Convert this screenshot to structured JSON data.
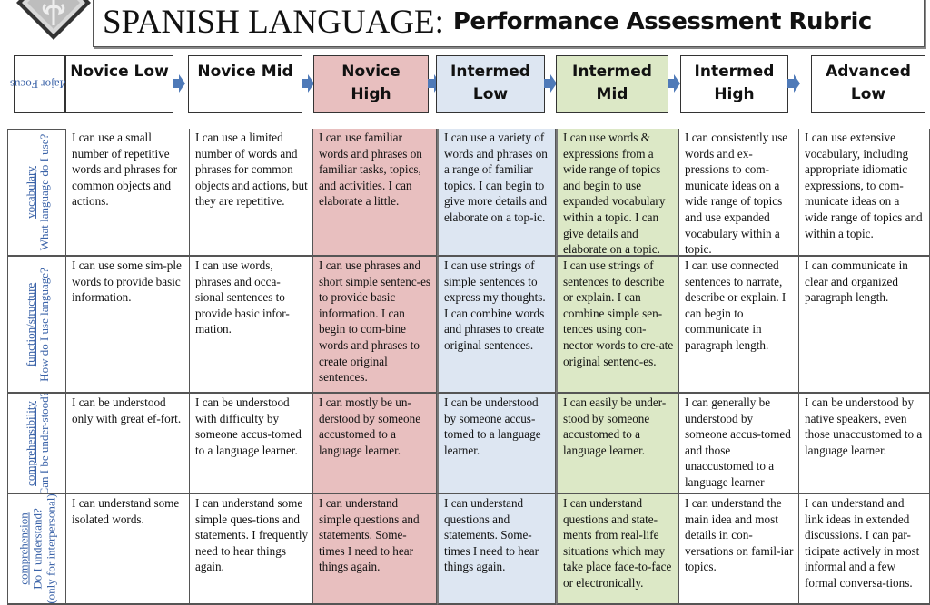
{
  "header": {
    "logo_icon": "fleur-de-lis-shield-icon",
    "title_main": "SPANISH LANGUAGE:",
    "title_sub": "Performance Assessment Rubric"
  },
  "major_focus_label": "Major Focus",
  "colors": {
    "novice_high_bg": "#e8bfbf",
    "intermed_low_bg": "#dde6f2",
    "intermed_mid_bg": "#dce8c6",
    "arrow": "#4f7ab8",
    "row_label": "#3b63a8"
  },
  "levels": [
    {
      "label": "Novice Low",
      "label_lines": [
        "Novice Low"
      ]
    },
    {
      "label": "Novice Mid",
      "label_lines": [
        "Novice Mid"
      ]
    },
    {
      "label": "Novice High",
      "label_lines": [
        "Novice",
        "High"
      ]
    },
    {
      "label": "Intermed Low",
      "label_lines": [
        "Intermed",
        "Low"
      ]
    },
    {
      "label": "Intermed Mid",
      "label_lines": [
        "Intermed",
        "Mid"
      ]
    },
    {
      "label": "Intermed High",
      "label_lines": [
        "Intermed",
        "High"
      ]
    },
    {
      "label": "Advanced Low",
      "label_lines": [
        "Advanced",
        "Low"
      ]
    }
  ],
  "rows": [
    {
      "focus": "vocabulary",
      "question": "What language do I use?",
      "cells": [
        "I can use a small number of repetitive words and phrases for common objects and actions.",
        "I can use a limited number of words and phrases for common objects and actions, but they are repetitive.",
        "I can use familiar words and phrases on familiar tasks, topics, and activities. I can elaborate a little.",
        "I can use a variety of words and phrases on a range of familiar topics. I can begin to give more details and elaborate on a top-ic.",
        "I can use words & expressions from a wide range of topics and begin to use expanded vocabulary within a topic. I can give details and elaborate on a topic.",
        "I can consistently use words and ex-pressions to com-municate ideas on a wide range of topics and use expanded vocabulary within a topic.",
        "I can use extensive vocabulary, including appropriate idiomatic expressions, to com-municate ideas on a wide range of topics and within a topic."
      ]
    },
    {
      "focus": "function/structure",
      "question": "How do I use language?",
      "cells": [
        "I can use some sim-ple words to provide basic information.",
        "I can use words, phrases and occa-sional sentences to provide basic infor-mation.",
        "I can use phrases and short simple sentenc-es to provide basic information. I can begin to com-bine words and phrases to create original sentences.",
        "I can use strings of simple sentences to express my thoughts. I can combine words and phrases to create original sentences.",
        "I can use strings of sentences to describe or explain. I can combine simple sen-tences using con-nector words to cre-ate original sentenc-es.",
        "I can use connected sentences to narrate, describe or explain. I can begin to communicate in paragraph length.",
        "I can communicate in clear and organized paragraph length."
      ]
    },
    {
      "focus": "comprehensibility",
      "question": "Can I be under-stood?",
      "cells": [
        "I can be understood only with great ef-fort.",
        "I can be understood with difficulty by someone accus-tomed to a language learner.",
        "I can mostly be un-derstood by someone accustomed to a language learner.",
        "I can be understood by someone accus-tomed to a language learner.",
        "I can easily be under-stood by someone accustomed to a language learner.",
        "I can generally be understood by someone accus-tomed and those unaccustomed to a language learner",
        "I can be understood by native speakers, even those unaccustomed to a language learner."
      ]
    },
    {
      "focus": "comprehension",
      "question": "Do I understand?",
      "note": "(only for interpersonal)",
      "cells": [
        "I can understand some isolated words.",
        "I can understand some simple ques-tions and statements. I frequently need to hear things again.",
        "I can understand simple questions and statements. Some-times I need to hear things again.",
        "I can understand questions and statements. Some-times I need to hear things again.",
        "I can understand questions and state-ments from real-life situations which may take place face-to-face or electronically.",
        "I can understand the main idea and most details in con-versations on famil-iar topics.",
        "I can understand and link ideas in extended discussions. I can par-ticipate actively in most informal and a few formal conversa-tions."
      ]
    }
  ]
}
